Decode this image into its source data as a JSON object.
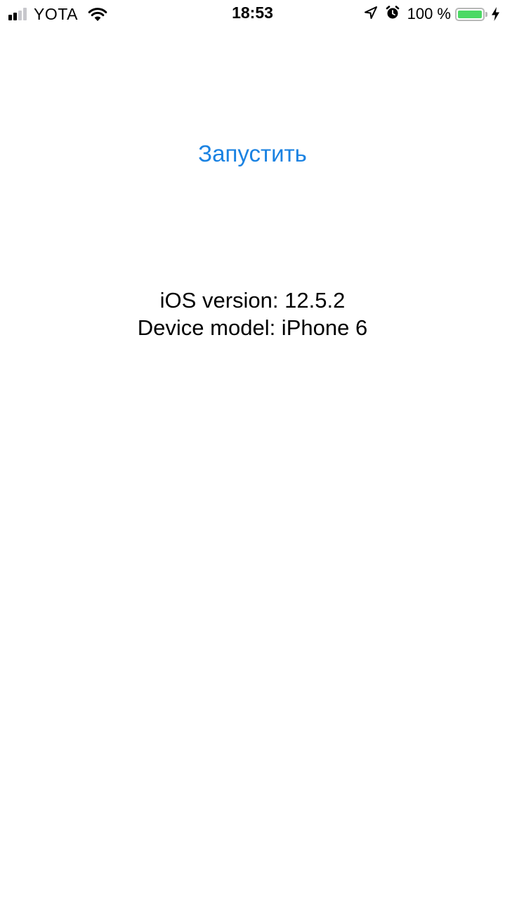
{
  "status_bar": {
    "carrier": "YOTA",
    "time": "18:53",
    "battery_percent": "100 %",
    "battery_level": 1.0,
    "signal_bars_filled": 2,
    "signal_bars_total": 4,
    "icons": [
      "signal-strength-icon",
      "wifi-icon",
      "location-arrow-icon",
      "alarm-clock-icon",
      "battery-icon",
      "charging-bolt-icon"
    ],
    "colors": {
      "battery_fill": "#4cd964",
      "signal_active": "#000000",
      "signal_inactive": "#c7c7cc"
    }
  },
  "main": {
    "launch_button_label": "Запустить",
    "launch_button_color": "#1a82e2",
    "ios_version_line": "iOS version: 12.5.2",
    "device_model_line": "Device model: iPhone 6"
  }
}
